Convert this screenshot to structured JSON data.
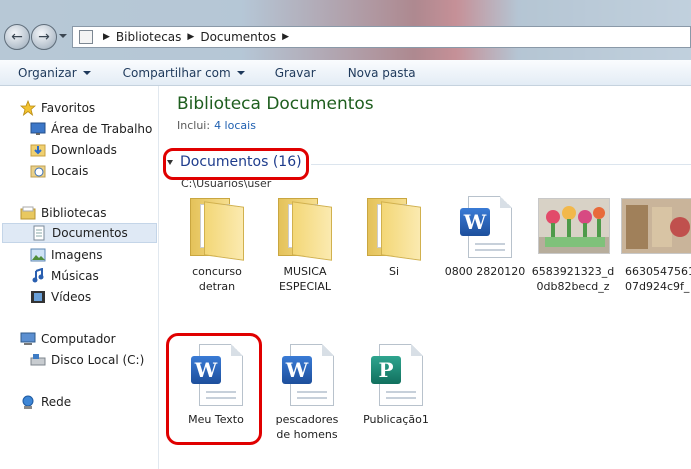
{
  "address": {
    "crumbs": [
      "Bibliotecas",
      "Documentos"
    ]
  },
  "commands": {
    "organizar": "Organizar",
    "compartilhar": "Compartilhar com",
    "gravar": "Gravar",
    "nova_pasta": "Nova pasta"
  },
  "nav": {
    "favoritos": "Favoritos",
    "area_trabalho": "Área de Trabalho",
    "downloads": "Downloads",
    "locais": "Locais",
    "bibliotecas": "Bibliotecas",
    "documentos": "Documentos",
    "imagens": "Imagens",
    "musicas": "Músicas",
    "videos": "Vídeos",
    "computador": "Computador",
    "disco_local": "Disco Local (C:)",
    "rede": "Rede"
  },
  "library": {
    "title": "Biblioteca Documentos",
    "includes_label": "Inclui:",
    "includes_link": "4 locais",
    "group_title": "Documentos (16)",
    "group_path": "C:\\Usuarios\\user"
  },
  "files": [
    {
      "line1": "concurso",
      "line2": "detran",
      "icon": "folder-icon"
    },
    {
      "line1": "MUSICA",
      "line2": "ESPECIAL",
      "icon": "folder-icon"
    },
    {
      "line1": "Si",
      "line2": "",
      "icon": "folder-icon"
    },
    {
      "line1": "0800 2820120",
      "line2": "",
      "icon": "word-document-icon"
    },
    {
      "line1": "6583921323_d",
      "line2": "0db82becd_z",
      "icon": "photo-thumbnail"
    },
    {
      "line1": "6630547561",
      "line2": "07d924c9f_",
      "icon": "photo-thumbnail"
    },
    {
      "line1": "Meu Texto",
      "line2": "",
      "icon": "word-document-icon"
    },
    {
      "line1": "pescadores",
      "line2": "de homens",
      "icon": "word-document-icon"
    },
    {
      "line1": "Publicação1",
      "line2": "",
      "icon": "publisher-document-icon"
    }
  ],
  "colors": {
    "highlight": "#e00000",
    "library_title": "#1e5e1e",
    "link": "#1e5fb0"
  }
}
